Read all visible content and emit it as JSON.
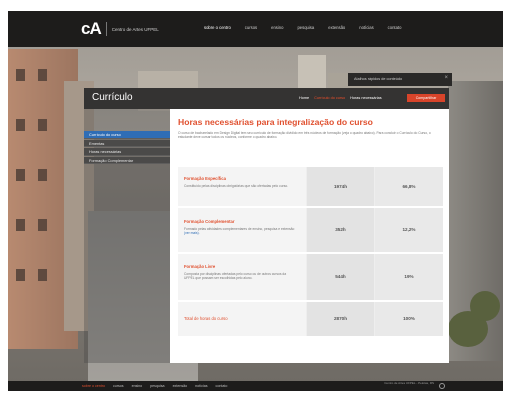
{
  "topbar": {
    "logo_mark": "cA",
    "logo_text": "Centro de Artes UFPEL",
    "nav": [
      "sobre o centro",
      "cursos",
      "ensino",
      "pesquisa",
      "extensão",
      "notícias",
      "contato"
    ],
    "active_index": 0
  },
  "popup": {
    "title": "Atalhos rápidos de conteúdo",
    "close_glyph": "×"
  },
  "modal": {
    "title": "Currículo",
    "breadcrumbs": [
      "Home",
      "Currículo do curso",
      "Horas necessárias"
    ],
    "share_label": "Compartilhar"
  },
  "sidebar": {
    "items": [
      {
        "label": "Currículo do curso"
      },
      {
        "label": "Ementas"
      },
      {
        "label": "Horas necessárias"
      },
      {
        "label": "Formação Complementar"
      }
    ],
    "active_index": 0
  },
  "content": {
    "title": "Horas necessárias para integralização do curso",
    "description": "O curso de bacharelado em Design Digital tem seu currículo de formação dividido em três núcleos de formação (veja o quadro abaixo). Para concluir o Currículo do Curso, o estudante deve cursar todos os núcleos, conforme o quadro abaixo.",
    "rows": [
      {
        "name": "Formação Específica",
        "desc": "Constituído pelas disciplinas obrigatórias que são ofertadas pelo curso.",
        "link": "",
        "hours": "1974h",
        "percent": "66,8%"
      },
      {
        "name": "Formação Complementar",
        "desc": "Formado pelas atividades complementares de ensino, pesquisa e extensão",
        "link": "(ver mais).",
        "hours": "352h",
        "percent": "12,2%"
      },
      {
        "name": "Formação Livre",
        "desc": "Composta por disciplinas ofertadas pelo curso ou de outros cursos da UFPEL que possam ser escolhidas pelo aluno.",
        "link": "",
        "hours": "544h",
        "percent": "19%"
      },
      {
        "name": "Total de horas do curso",
        "desc": "",
        "link": "",
        "hours": "2870h",
        "percent": "100%"
      }
    ]
  },
  "footer": {
    "nav": [
      "sobre o centro",
      "cursos",
      "ensino",
      "pesquisa",
      "extensão",
      "notícias",
      "contato"
    ],
    "active_index": 0,
    "credit": "Centro de Artes UFPEL - Pelotas, RS"
  },
  "colors": {
    "accent": "#e0502f",
    "active_blue": "#2f6db5",
    "dark_bar": "#1d1c1b",
    "share_button": "#d8442a"
  }
}
